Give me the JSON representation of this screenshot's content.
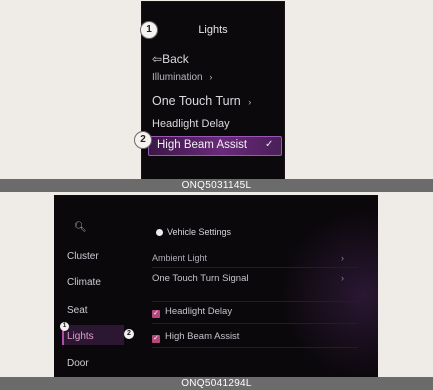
{
  "panel1": {
    "markers": [
      "1",
      "2"
    ],
    "title": "Lights",
    "items": {
      "back": "Back",
      "illumination": "Illumination",
      "one_touch": "One Touch Turn",
      "headlight_delay": "Headlight Delay",
      "high_beam_assist": "High Beam Assist"
    },
    "caption": "ONQ5031145L"
  },
  "panel2": {
    "sidebar": {
      "items": [
        "Cluster",
        "Climate",
        "Seat",
        "Lights",
        "Door"
      ],
      "selected": "Lights",
      "marker": "1"
    },
    "main": {
      "header": "Vehicle Settings",
      "rows": {
        "ambient": "Ambient Light",
        "one_touch": "One Touch Turn Signal",
        "headlight_delay": "Headlight Delay",
        "high_beam_assist": "High Beam Assist"
      },
      "marker": "2"
    },
    "caption": "ONQ5041294L"
  },
  "colors": {
    "screen_bg": "#0c090c",
    "highlight": "#6a2a7a",
    "accent": "#b3487a",
    "caption_bg": "#6b6b6b"
  }
}
